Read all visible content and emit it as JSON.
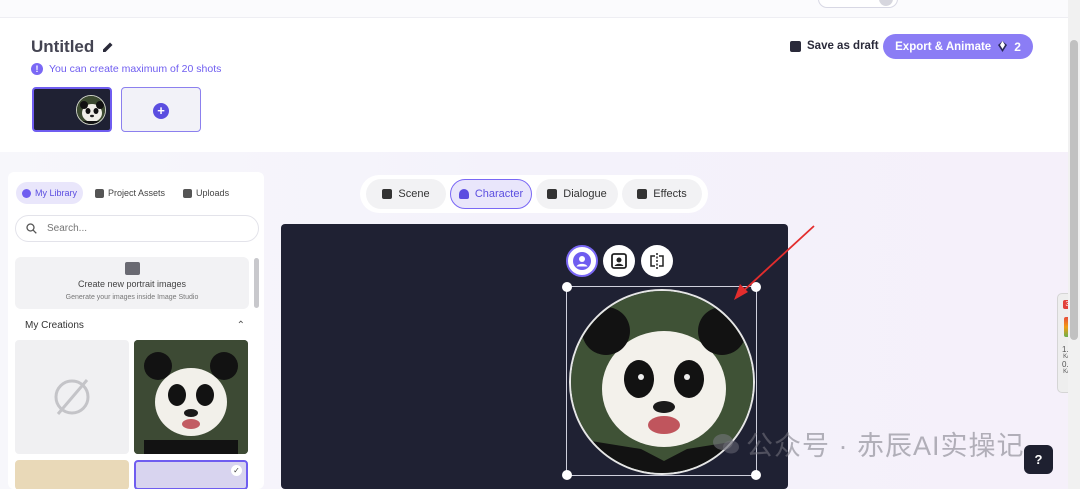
{
  "header": {
    "title": "Untitled",
    "info_text": "You can create maximum of 20 shots",
    "info_icon": "!",
    "save_draft": "Save as draft",
    "export_label": "Export & Animate",
    "export_count": "2"
  },
  "library": {
    "tabs": [
      {
        "label": "My Library"
      },
      {
        "label": "Project Assets"
      },
      {
        "label": "Uploads"
      }
    ],
    "search_placeholder": "Search...",
    "create_title": "Create new portrait images",
    "create_subtitle": "Generate your images inside Image Studio",
    "section_title": "My Creations"
  },
  "editor": {
    "tabs": [
      {
        "label": "Scene"
      },
      {
        "label": "Character"
      },
      {
        "label": "Dialogue"
      },
      {
        "label": "Effects"
      }
    ],
    "active_tab": "Character"
  },
  "side_widget": {
    "badge": "3",
    "val1": "1.3",
    "unit1": "K/s",
    "val2": "0.3",
    "unit2": "K/s"
  },
  "help_label": "?",
  "watermark": "公众号 · 赤辰AI实操记",
  "colors": {
    "accent": "#6f5df0",
    "export_bg": "#8b7df5",
    "canvas_bg": "#1f2133"
  }
}
